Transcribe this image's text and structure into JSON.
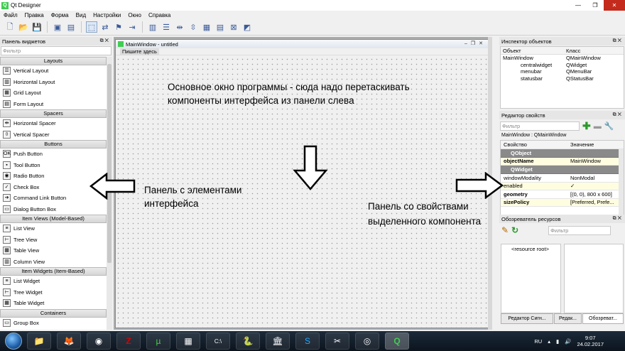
{
  "app": {
    "title": "Qt Designer"
  },
  "menu": [
    "Файл",
    "Правка",
    "Форма",
    "Вид",
    "Настройки",
    "Окно",
    "Справка"
  ],
  "widget_panel": {
    "title": "Панель виджетов",
    "filter_placeholder": "Фильтр",
    "categories": [
      {
        "name": "Layouts",
        "items": [
          {
            "label": "Vertical Layout",
            "icon": "vertical-layout-icon"
          },
          {
            "label": "Horizontal Layout",
            "icon": "horizontal-layout-icon"
          },
          {
            "label": "Grid Layout",
            "icon": "grid-layout-icon"
          },
          {
            "label": "Form Layout",
            "icon": "form-layout-icon"
          }
        ]
      },
      {
        "name": "Spacers",
        "items": [
          {
            "label": "Horizontal Spacer",
            "icon": "horizontal-spacer-icon"
          },
          {
            "label": "Vertical Spacer",
            "icon": "vertical-spacer-icon"
          }
        ]
      },
      {
        "name": "Buttons",
        "items": [
          {
            "label": "Push Button",
            "icon": "push-button-icon"
          },
          {
            "label": "Tool Button",
            "icon": "tool-button-icon"
          },
          {
            "label": "Radio Button",
            "icon": "radio-button-icon"
          },
          {
            "label": "Check Box",
            "icon": "check-box-icon"
          },
          {
            "label": "Command Link Button",
            "icon": "command-link-icon"
          },
          {
            "label": "Dialog Button Box",
            "icon": "dialog-button-box-icon"
          }
        ]
      },
      {
        "name": "Item Views (Model-Based)",
        "items": [
          {
            "label": "List View",
            "icon": "list-view-icon"
          },
          {
            "label": "Tree View",
            "icon": "tree-view-icon"
          },
          {
            "label": "Table View",
            "icon": "table-view-icon"
          },
          {
            "label": "Column View",
            "icon": "column-view-icon"
          }
        ]
      },
      {
        "name": "Item Widgets (Item-Based)",
        "items": [
          {
            "label": "List Widget",
            "icon": "list-widget-icon"
          },
          {
            "label": "Tree Widget",
            "icon": "tree-widget-icon"
          },
          {
            "label": "Table Widget",
            "icon": "table-widget-icon"
          }
        ]
      },
      {
        "name": "Containers",
        "items": [
          {
            "label": "Group Box",
            "icon": "group-box-icon"
          }
        ]
      }
    ]
  },
  "form": {
    "title": "MainWindow - untitled",
    "menu_placeholder": "Пишите здесь"
  },
  "annotations": {
    "center": "Основное окно программы - сюда надо перетаскивать компоненты интерфейса из панели слева",
    "left": "Панель с элементами интерфейса",
    "right": "Панель со свойствами выделенного компонента"
  },
  "object_inspector": {
    "title": "Инспектор объектов",
    "col_object": "Объект",
    "col_class": "Класс",
    "rows": [
      {
        "object": "MainWindow",
        "class": "QMainWindow"
      },
      {
        "object": "centralwidget",
        "class": "QWidget"
      },
      {
        "object": "menubar",
        "class": "QMenuBar"
      },
      {
        "object": "statusbar",
        "class": "QStatusBar"
      }
    ]
  },
  "property_editor": {
    "title": "Редактор свойств",
    "filter_placeholder": "Фильтр",
    "context": "MainWindow : QMainWindow",
    "col_property": "Свойство",
    "col_value": "Значение",
    "group1": "QObject",
    "group2": "QWidget",
    "rows1": [
      {
        "name": "objectName",
        "value": "MainWindow"
      }
    ],
    "rows2": [
      {
        "name": "windowModality",
        "value": "NonModal"
      },
      {
        "name": "enabled",
        "value": "✓"
      },
      {
        "name": "geometry",
        "value": "[(0, 0), 800 x 600]"
      },
      {
        "name": "sizePolicy",
        "value": "[Preferred, Prefe..."
      }
    ]
  },
  "resource_browser": {
    "title": "Обозреватель ресурсов",
    "filter_placeholder": "Фильтр",
    "root": "<resource root>"
  },
  "bottom_tabs": [
    "Редактор Сигн...",
    "Редак...",
    "Обозреват..."
  ],
  "taskbar": {
    "lang": "RU",
    "time": "9:07",
    "date": "24.02.2017"
  }
}
